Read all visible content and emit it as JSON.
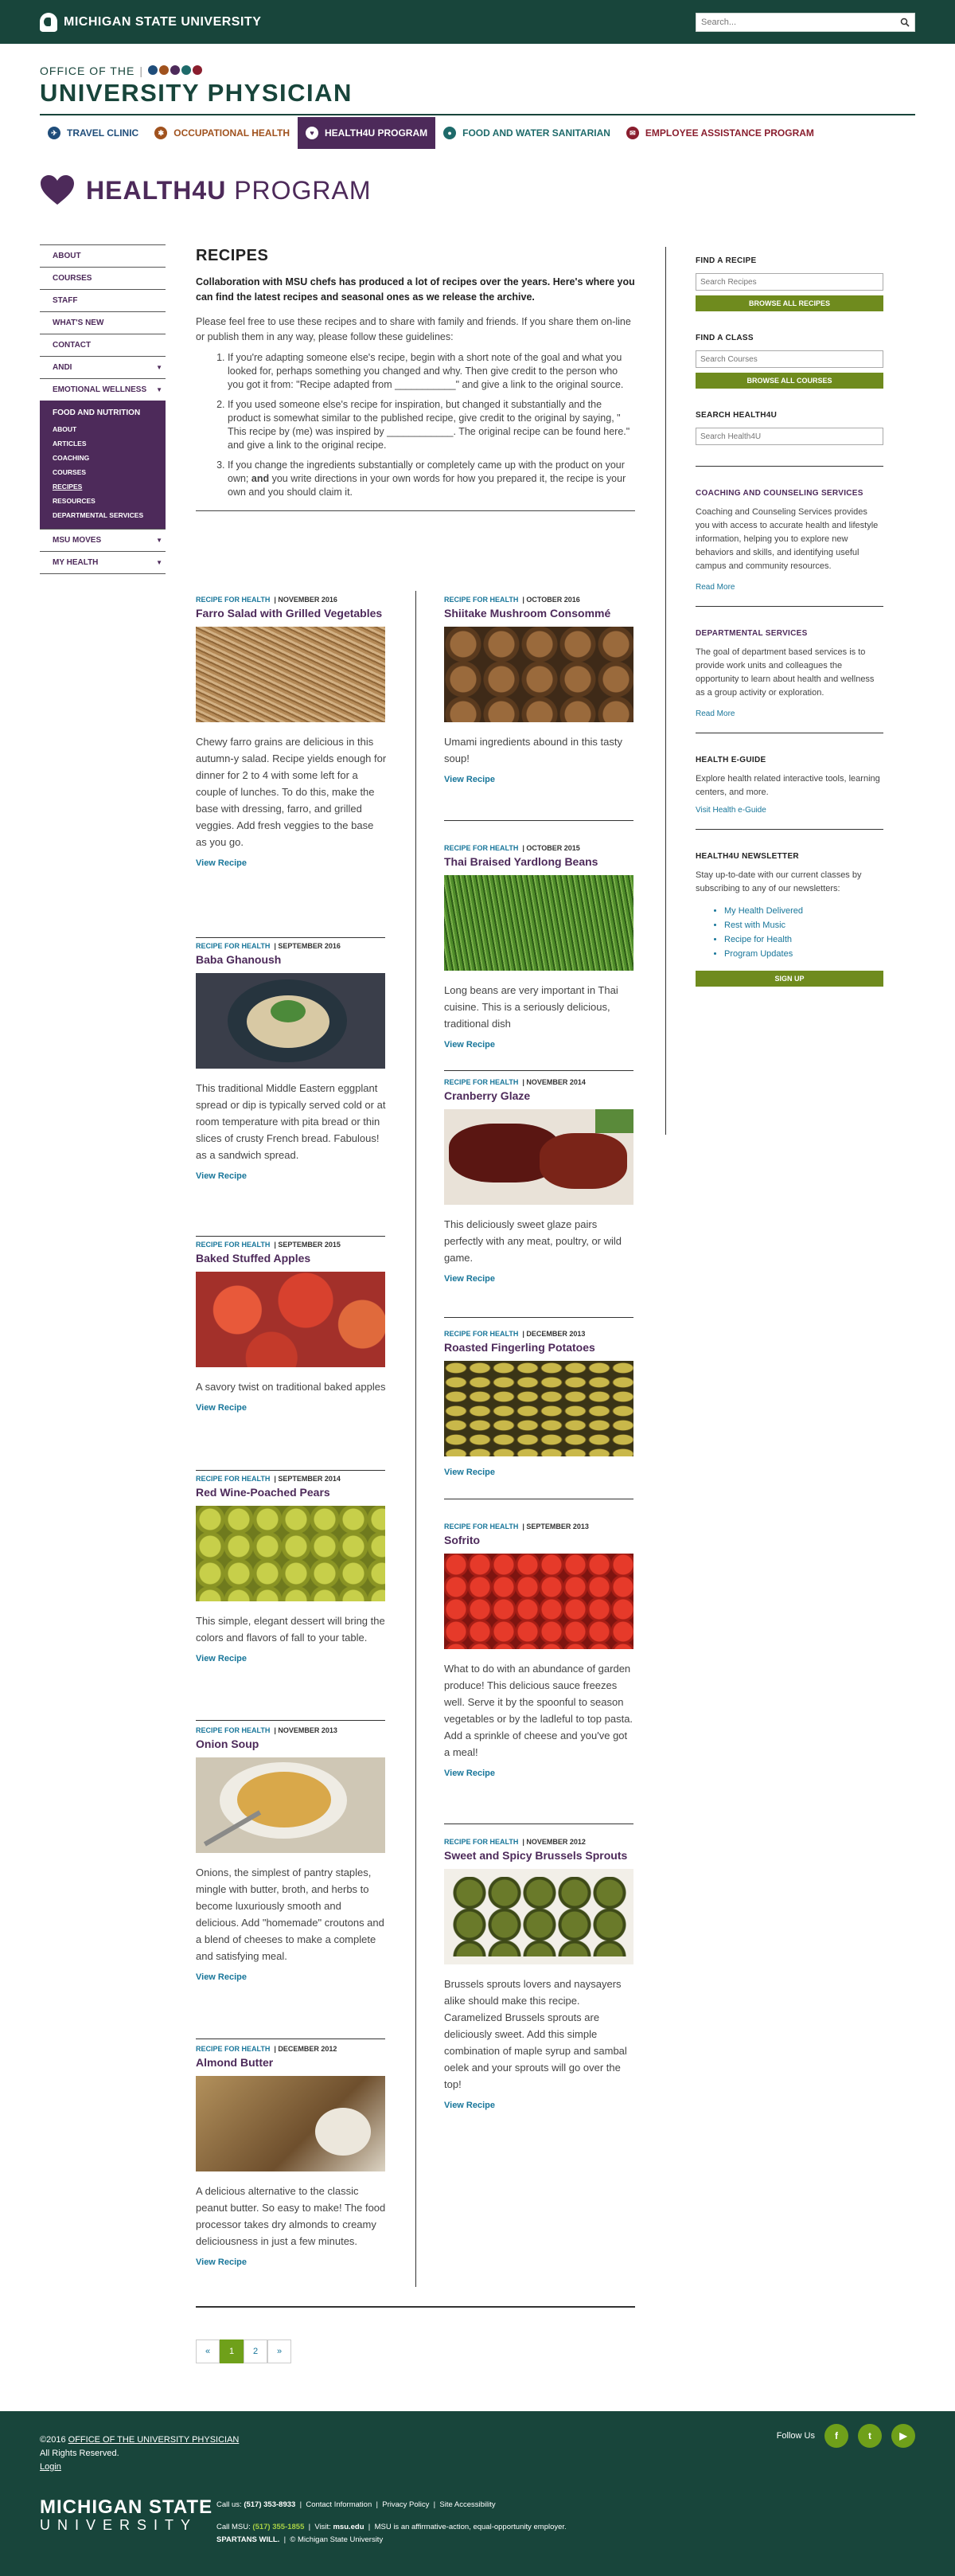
{
  "topbar": {
    "university": "MICHIGAN STATE UNIVERSITY",
    "search_placeholder": "Search..."
  },
  "office": {
    "small": "OFFICE OF THE",
    "big": "UNIVERSITY PHYSICIAN"
  },
  "programs": [
    {
      "label": "TRAVEL CLINIC",
      "color": "#1f4d7a"
    },
    {
      "label": "OCCUPATIONAL HEALTH",
      "color": "#a0521e"
    },
    {
      "label": "HEALTH4U PROGRAM",
      "color": "#4d2a5a"
    },
    {
      "label": "FOOD AND WATER SANITARIAN",
      "color": "#1e6a6a"
    },
    {
      "label": "EMPLOYEE ASSISTANCE PROGRAM",
      "color": "#8a1e2e"
    }
  ],
  "h4u": {
    "bold": "HEALTH4U",
    "rest": " PROGRAM"
  },
  "nav": {
    "about": "ABOUT",
    "courses": "COURSES",
    "staff": "STAFF",
    "whats_new": "WHAT'S NEW",
    "contact": "CONTACT",
    "andi": "ANDI",
    "emotional": "EMOTIONAL WELLNESS",
    "food": "FOOD AND NUTRITION",
    "sub": [
      "ABOUT",
      "ARTICLES",
      "COACHING",
      "COURSES",
      "RECIPES",
      "RESOURCES",
      "DEPARTMENTAL SERVICES"
    ],
    "moves": "MSU MOVES",
    "health": "MY HEALTH"
  },
  "main": {
    "title": "RECIPES",
    "lead": "Collaboration with MSU chefs has produced a lot of recipes over the years. Here's where you can find the latest recipes and seasonal ones as we release the archive.",
    "intro": "Please feel free to use these recipes and to share with family and friends. If you share them on-line or publish them in any way, please follow these guidelines:",
    "g1": "If you're adapting someone else's recipe, begin with a short note of the goal and what you looked for, perhaps something you changed and why. Then give credit to the person who you got it from: \"Recipe adapted from ___________\" and give a link to the original source.",
    "g2": "If you used someone else's recipe for inspiration, but changed it substantially and the product is somewhat similar to the published recipe, give credit to the original by saying, \" This recipe by (me) was inspired by ____________. The original recipe can be found here.\" and give a link to the original recipe.",
    "g3a": "If you change the ingredients substantially or completely came up with the product on your own; ",
    "g3b": "and",
    "g3c": " you write directions in your own words for how you prepared it, the recipe is your own and you should claim it."
  },
  "cards": [
    {
      "cat": "RECIPE FOR HEALTH",
      "date": "NOVEMBER 2016",
      "title": "Farro Salad with Grilled Vegetables",
      "desc": "Chewy farro grains are delicious in this autumn-y salad. Recipe yields enough for dinner for 2 to 4 with some left for a couple of lunches. To do this, make the base with dressing, farro, and grilled veggies. Add fresh veggies to the base as you go.",
      "link": "View Recipe"
    },
    {
      "cat": "RECIPE FOR HEALTH",
      "date": "OCTOBER 2016",
      "title": "Shiitake Mushroom Consommé",
      "desc": "Umami ingredients abound in this tasty soup!",
      "link": "View Recipe"
    },
    {
      "cat": "RECIPE FOR HEALTH",
      "date": "OCTOBER 2015",
      "title": "Thai Braised Yardlong Beans",
      "desc": "Long beans are very important in Thai cuisine. This is a seriously delicious, traditional dish",
      "link": "View Recipe"
    },
    {
      "cat": "RECIPE FOR HEALTH",
      "date": "SEPTEMBER 2016",
      "title": "Baba Ghanoush",
      "desc": "This traditional Middle Eastern eggplant spread or dip is typically served cold or at room temperature with pita bread or thin slices of crusty French bread. Fabulous! as a sandwich spread.",
      "link": "View Recipe"
    },
    {
      "cat": "RECIPE FOR HEALTH",
      "date": "NOVEMBER 2014",
      "title": "Cranberry Glaze",
      "desc": "This deliciously sweet glaze pairs perfectly with any meat, poultry, or wild game.",
      "link": "View Recipe"
    },
    {
      "cat": "RECIPE FOR HEALTH",
      "date": "SEPTEMBER 2015",
      "title": "Baked Stuffed Apples",
      "desc": "A savory twist on traditional baked apples",
      "link": "View Recipe"
    },
    {
      "cat": "RECIPE FOR HEALTH",
      "date": "DECEMBER 2013",
      "title": "Roasted Fingerling Potatoes",
      "desc": "",
      "link": "View Recipe"
    },
    {
      "cat": "RECIPE FOR HEALTH",
      "date": "SEPTEMBER 2014",
      "title": "Red Wine-Poached Pears",
      "desc": "This simple, elegant dessert will bring the colors and flavors of fall to your table.",
      "link": "View Recipe"
    },
    {
      "cat": "RECIPE FOR HEALTH",
      "date": "SEPTEMBER 2013",
      "title": "Sofrito",
      "desc": "What to do with an abundance of garden produce! This delicious sauce freezes well. Serve it by the spoonful to season vegetables or by the ladleful to top pasta. Add a sprinkle of cheese and you've got a meal!",
      "link": "View Recipe"
    },
    {
      "cat": "RECIPE FOR HEALTH",
      "date": "NOVEMBER 2013",
      "title": "Onion Soup",
      "desc": "Onions, the simplest of pantry staples, mingle with butter, broth, and herbs to become luxuriously smooth and delicious. Add \"homemade\" croutons and a blend of cheeses to make a complete and satisfying meal.",
      "link": "View Recipe"
    },
    {
      "cat": "RECIPE FOR HEALTH",
      "date": "NOVEMBER 2012",
      "title": "Sweet and Spicy Brussels Sprouts",
      "desc": "Brussels sprouts lovers and naysayers alike should make this recipe. Caramelized Brussels sprouts are deliciously sweet. Add this simple combination of maple syrup and sambal oelek and your sprouts will go over the top!",
      "link": "View Recipe"
    },
    {
      "cat": "RECIPE FOR HEALTH",
      "date": "DECEMBER 2012",
      "title": "Almond Butter",
      "desc": "A delicious alternative to the classic peanut butter. So easy to make! The food processor takes dry almonds to creamy deliciousness in just a few minutes.",
      "link": "View Recipe"
    }
  ],
  "pager": {
    "prev": "«",
    "p1": "1",
    "p2": "2",
    "next": "»"
  },
  "sidebar": {
    "find_recipe": "FIND A RECIPE",
    "recipe_ph": "Search Recipes",
    "browse_recipes": "BROWSE ALL RECIPES",
    "find_class": "FIND A CLASS",
    "class_ph": "Search Courses",
    "browse_courses": "BROWSE ALL COURSES",
    "search_h4u": "SEARCH HEALTH4U",
    "h4u_ph": "Search Health4U",
    "coach_title": "COACHING AND COUNSELING SERVICES",
    "coach_text": "Coaching and Counseling Services provides you with access to accurate health and lifestyle information, helping you to explore new behaviors and skills, and identifying useful campus and community resources.",
    "more1": "Read More",
    "dept_title": "DEPARTMENTAL SERVICES",
    "dept_text": "The goal of department based services is to provide work units and colleagues the opportunity to learn about health and wellness as a group activity or exploration.",
    "more2": "Read More",
    "eguide_title": "HEALTH E-GUIDE",
    "eguide_text": "Explore health related interactive tools, learning centers, and more.",
    "eguide_link": "Visit Health e-Guide",
    "news_title": "HEALTH4U NEWSLETTER",
    "news_text": "Stay up-to-date with our current classes by subscribing to any of our newsletters:",
    "news": [
      "My Health Delivered",
      "Rest with Music",
      "Recipe for Health",
      "Program Updates"
    ],
    "signup": "SIGN UP"
  },
  "footer": {
    "year": "©2016",
    "office_link": "OFFICE OF THE UNIVERSITY PHYSICIAN",
    "rights": "All Rights Reserved.",
    "login": "Login",
    "follow": "Follow Us",
    "msu1": "MICHIGAN STATE",
    "msu2": "UNIVERSITY",
    "call": "Call us: ",
    "phone": "(517) 353-8933",
    "contact": "Contact Information",
    "privacy": "Privacy Policy",
    "access": "Site Accessibility",
    "call_msu": "Call MSU: ",
    "msu_phone": "(517) 355-1855",
    "visit": "Visit: ",
    "msu_url": "msu.edu",
    "aa": "MSU is an affirmative-action, equal-opportunity employer.",
    "spartans": "SPARTANS WILL.",
    "copyright": "© Michigan State University"
  }
}
